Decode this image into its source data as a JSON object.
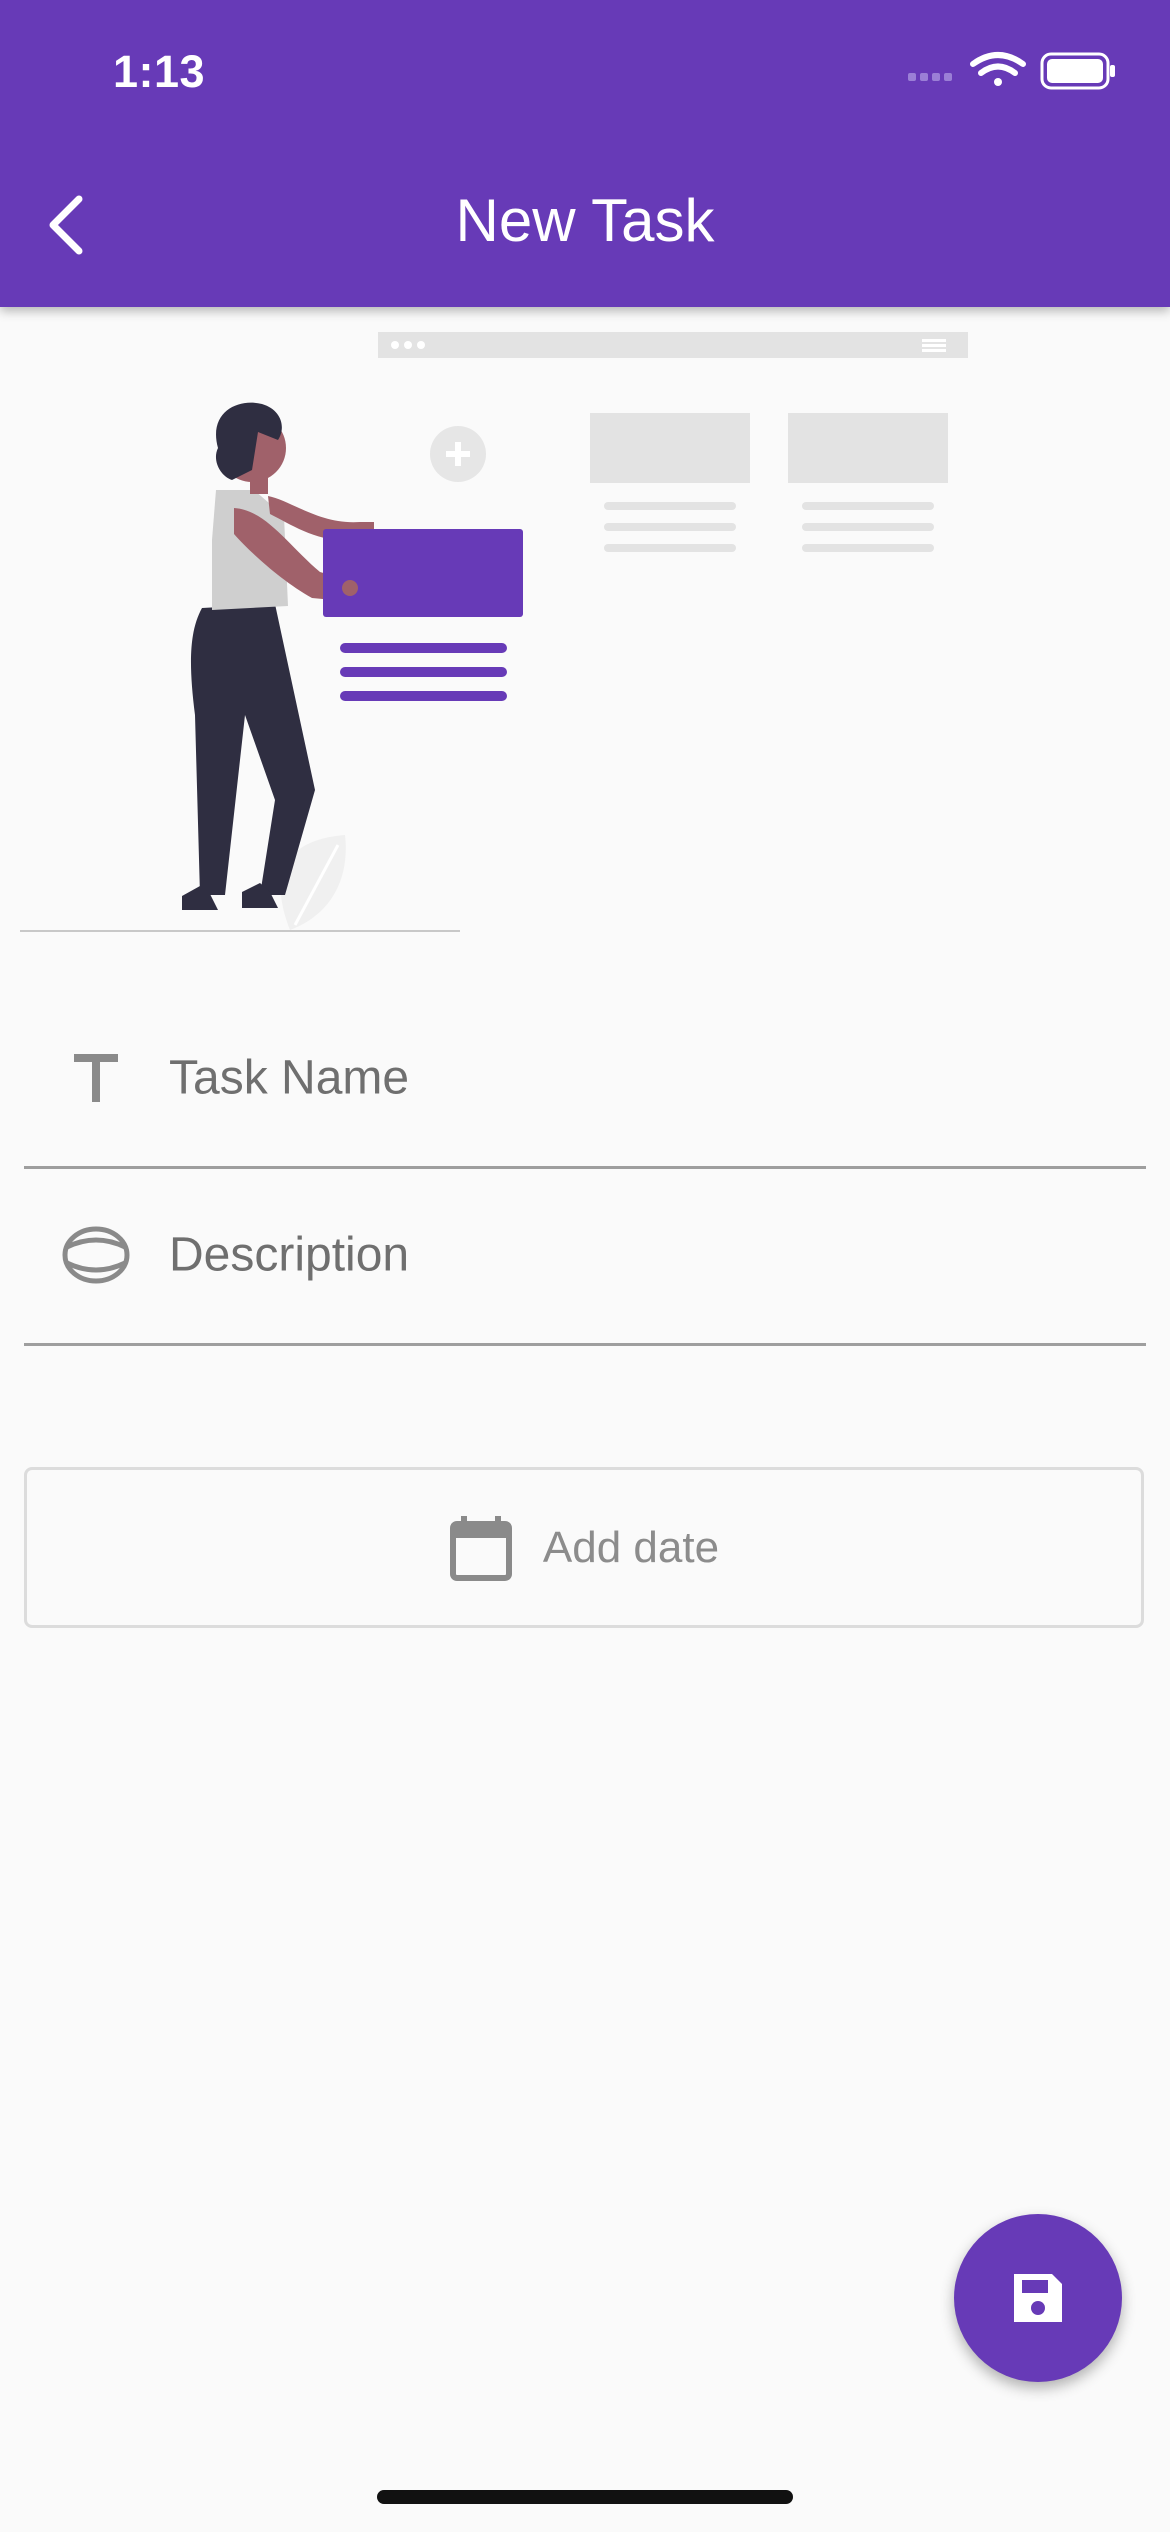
{
  "status_bar": {
    "time": "1:13"
  },
  "app_bar": {
    "title": "New Task",
    "background": "#673ab7"
  },
  "form": {
    "task_name": {
      "value": "",
      "placeholder": "Task Name",
      "icon": "text-icon"
    },
    "description": {
      "value": "",
      "placeholder": "Description",
      "icon": "description-icon"
    },
    "date_button": {
      "label": "Add date",
      "icon": "calendar-icon"
    }
  },
  "fab": {
    "icon": "save-icon"
  },
  "colors": {
    "accent": "#673ab7",
    "background": "#fafafa",
    "divider": "#9e9e9e"
  }
}
